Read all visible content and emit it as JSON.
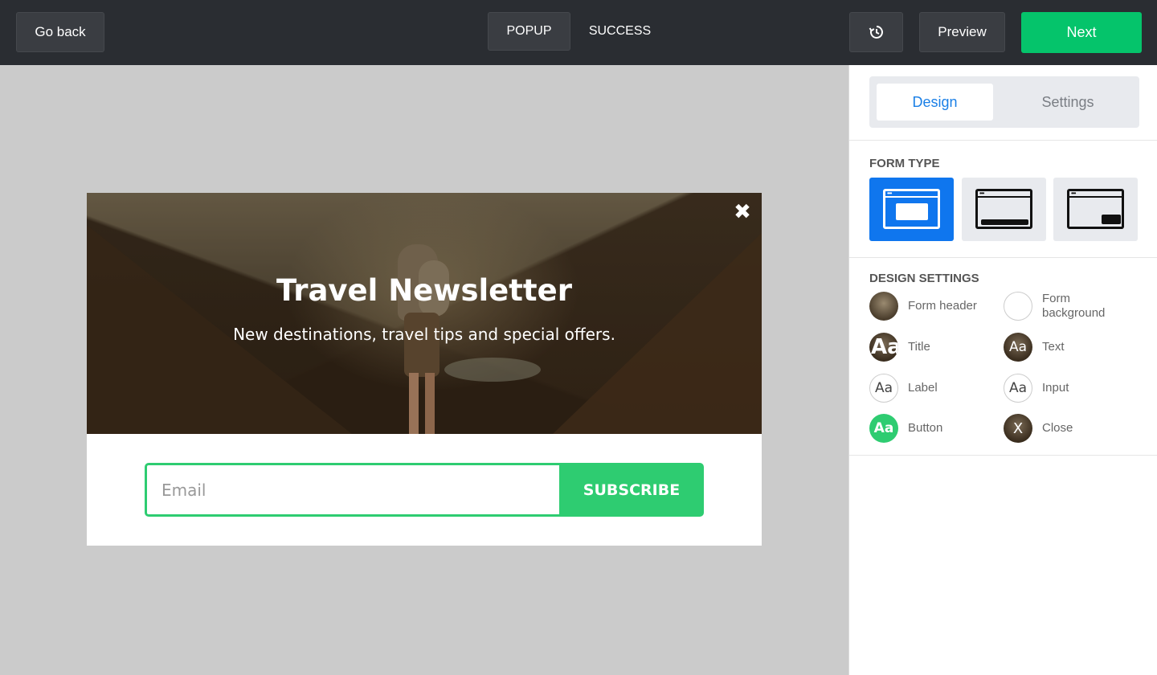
{
  "topbar": {
    "go_back": "Go back",
    "tabs": [
      {
        "label": "POPUP",
        "active": true
      },
      {
        "label": "SUCCESS",
        "active": false
      }
    ],
    "history_icon": "history-icon",
    "preview": "Preview",
    "next": "Next"
  },
  "popup": {
    "title": "Travel Newsletter",
    "text": "New destinations, travel tips and special offers.",
    "close_glyph": "✖",
    "email_placeholder": "Email",
    "subscribe": "SUBSCRIBE"
  },
  "sidebar": {
    "tabs": {
      "design": "Design",
      "settings": "Settings"
    },
    "form_type_title": "FORM TYPE",
    "form_types": [
      {
        "kind": "popup",
        "selected": true
      },
      {
        "kind": "bar",
        "selected": false
      },
      {
        "kind": "corner",
        "selected": false
      }
    ],
    "design_settings_title": "DESIGN SETTINGS",
    "design_settings": [
      {
        "label": "Form header",
        "swatch": ""
      },
      {
        "label": "Form background",
        "swatch": ""
      },
      {
        "label": "Title",
        "swatch": "Aa"
      },
      {
        "label": "Text",
        "swatch": "Aa"
      },
      {
        "label": "Label",
        "swatch": "Aa"
      },
      {
        "label": "Input",
        "swatch": "Aa"
      },
      {
        "label": "Button",
        "swatch": "Aa"
      },
      {
        "label": "Close",
        "swatch": "X"
      }
    ]
  },
  "colors": {
    "accent_green": "#05c46b",
    "subscribe_green": "#2ecc71",
    "selected_blue": "#0f76ee",
    "topbar_bg": "#2a2d32"
  }
}
